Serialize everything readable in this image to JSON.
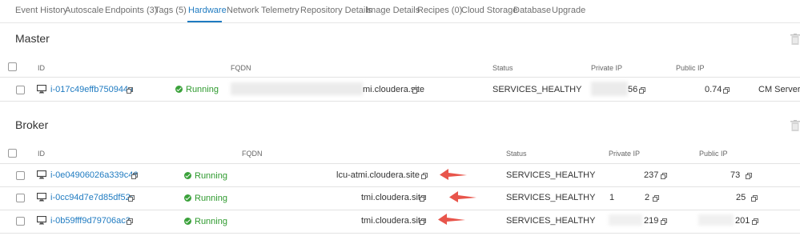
{
  "tabs": [
    {
      "label": "Event History"
    },
    {
      "label": "Autoscale"
    },
    {
      "label": "Endpoints (3)"
    },
    {
      "label": "Tags (5)"
    },
    {
      "label": "Hardware",
      "active": true
    },
    {
      "label": "Network"
    },
    {
      "label": "Telemetry"
    },
    {
      "label": "Repository Details"
    },
    {
      "label": "Image Details"
    },
    {
      "label": "Recipes (0)"
    },
    {
      "label": "Cloud Storage"
    },
    {
      "label": "Database"
    },
    {
      "label": "Upgrade"
    }
  ],
  "colors": {
    "accent": "#1f7bc1",
    "running": "#2e9a2e",
    "arrow": "#e8554b"
  },
  "master": {
    "title": "Master",
    "headers": {
      "id": "ID",
      "fqdn": "FQDN",
      "status": "Status",
      "private_ip": "Private IP",
      "public_ip": "Public IP"
    },
    "rows": [
      {
        "id": "i-017c49effb750944a",
        "state": "Running",
        "fqdn": "mi.cloudera.site",
        "status": "SERVICES_HEALTHY",
        "private_ip": "56",
        "public_ip": "0.74",
        "role": "CM Server"
      }
    ]
  },
  "broker": {
    "title": "Broker",
    "headers": {
      "id": "ID",
      "fqdn": "FQDN",
      "status": "Status",
      "private_ip": "Private IP",
      "public_ip": "Public IP"
    },
    "rows": [
      {
        "id": "i-0e04906026a339c46",
        "state": "Running",
        "fqdn": "lcu-atmi.cloudera.site",
        "status": "SERVICES_HEALTHY",
        "private_ip": "237",
        "public_ip": "73"
      },
      {
        "id": "i-0cc94d7e7d85df52c",
        "state": "Running",
        "fqdn": "tmi.cloudera.site",
        "status": "SERVICES_HEALTHY",
        "private_ip_a": "1",
        "private_ip_b": "2",
        "public_ip": "25"
      },
      {
        "id": "i-0b59fff9d79706ac3",
        "state": "Running",
        "fqdn": "tmi.cloudera.site",
        "status": "SERVICES_HEALTHY",
        "private_ip": "219",
        "public_ip": "201"
      }
    ]
  }
}
